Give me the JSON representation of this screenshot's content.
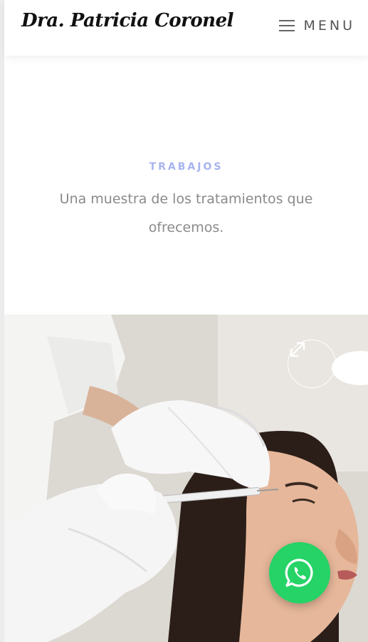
{
  "header": {
    "logo_text": "Dra. Patricia Coronel",
    "menu_label": "MENU"
  },
  "section": {
    "kicker": "TRABAJOS",
    "description": "Una muestra de los tratamientos que ofrecemos."
  },
  "gallery": {
    "expand_icon": "expand-icon"
  },
  "floating": {
    "whatsapp_icon": "whatsapp-icon"
  },
  "colors": {
    "kicker": "#a8b4ee",
    "description": "#8a8a8a",
    "whatsapp": "#25d366"
  }
}
